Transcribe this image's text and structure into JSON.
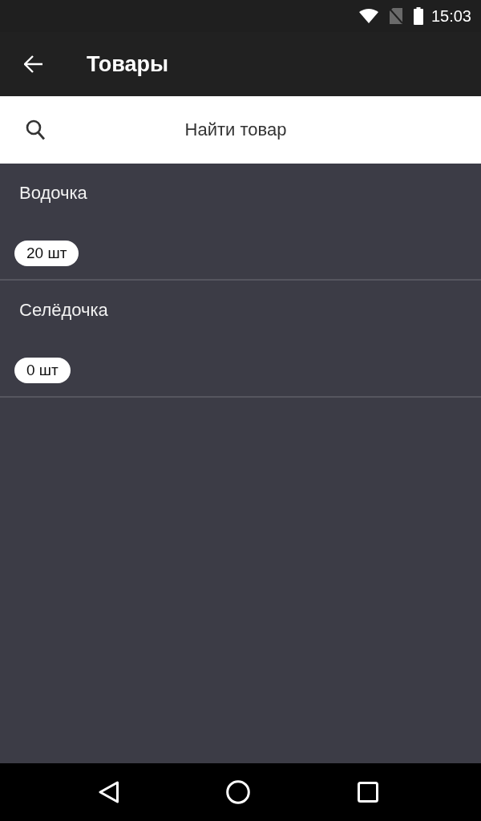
{
  "status_bar": {
    "time": "15:03"
  },
  "toolbar": {
    "title": "Товары"
  },
  "search": {
    "placeholder": "Найти товар"
  },
  "items": [
    {
      "name": "Водочка",
      "quantity": "20 шт"
    },
    {
      "name": "Селёдочка",
      "quantity": "0 шт"
    }
  ]
}
